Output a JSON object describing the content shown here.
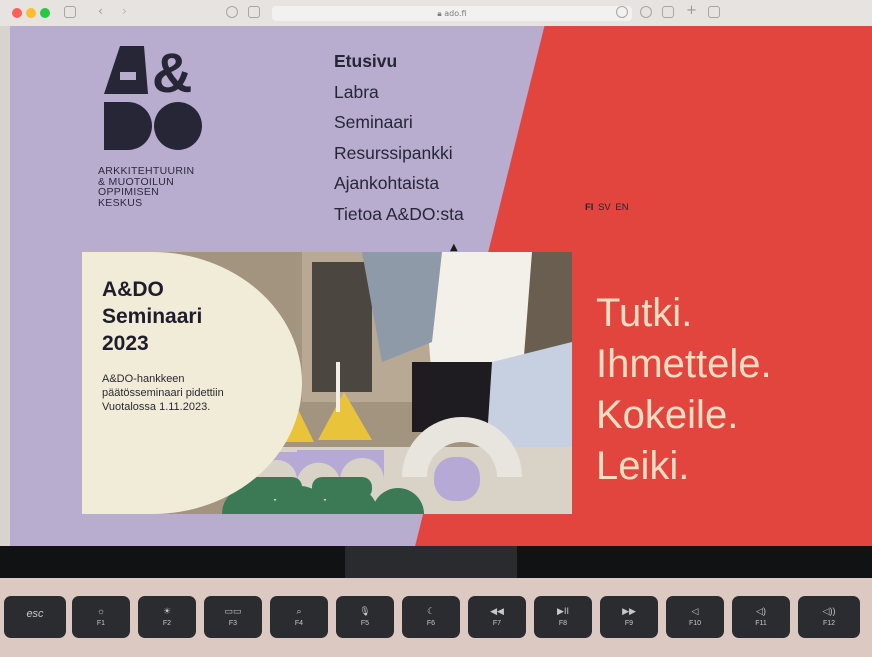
{
  "browser": {
    "url": "ado.fi",
    "traffic_lights": [
      "#ff5f57",
      "#febc2e",
      "#28c840"
    ]
  },
  "site": {
    "logo_lines": [
      "ARKKITEHTUURIN",
      "& MUOTOILUN",
      "OPPIMISEN",
      "KESKUS"
    ],
    "nav": [
      {
        "label": "Etusivu",
        "active": true
      },
      {
        "label": "Labra"
      },
      {
        "label": "Seminaari"
      },
      {
        "label": "Resurssipankki"
      },
      {
        "label": "Ajankohtaista"
      },
      {
        "label": "Tietoa A&DO:sta"
      }
    ],
    "languages": [
      "FI",
      "SV",
      "EN"
    ],
    "active_language": "FI",
    "hero": {
      "title_lines": [
        "A&DO",
        "Seminaari",
        "2023"
      ],
      "text_lines": [
        "A&DO-hankkeen",
        "päätösseminaari pidettiin",
        "Vuotalossa 1.11.2023."
      ]
    },
    "slogan": [
      "Tutki.",
      "Ihmettele.",
      "Kokeile.",
      "Leiki."
    ],
    "colors": {
      "lavender": "#b9adcf",
      "red": "#e2453d",
      "cream": "#f1ecd7",
      "slogan_text": "#f4ddc3",
      "ink": "#262636"
    }
  },
  "keyboard": {
    "keys": [
      {
        "label": "esc",
        "icon": ""
      },
      {
        "label": "F1",
        "icon": "☼"
      },
      {
        "label": "F2",
        "icon": "☀"
      },
      {
        "label": "F3",
        "icon": "▭▭"
      },
      {
        "label": "F4",
        "icon": "⌕"
      },
      {
        "label": "F5",
        "icon": "🎙"
      },
      {
        "label": "F6",
        "icon": "☾"
      },
      {
        "label": "F7",
        "icon": "◀◀"
      },
      {
        "label": "F8",
        "icon": "▶II"
      },
      {
        "label": "F9",
        "icon": "▶▶"
      },
      {
        "label": "F10",
        "icon": "◁"
      },
      {
        "label": "F11",
        "icon": "◁)"
      },
      {
        "label": "F12",
        "icon": "◁))"
      }
    ]
  }
}
